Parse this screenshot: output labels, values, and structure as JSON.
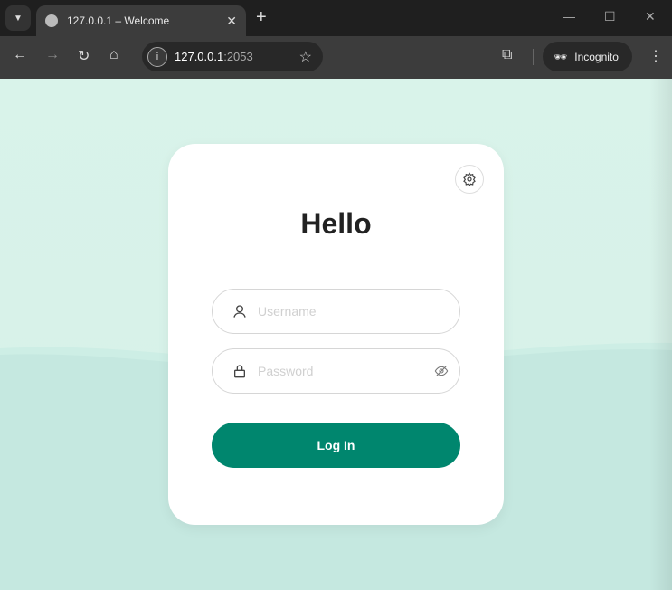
{
  "browser": {
    "tab_title": "127.0.0.1 – Welcome",
    "url_host": "127.0.0.1",
    "url_port": ":2053",
    "incognito_label": "Incognito"
  },
  "login": {
    "title": "Hello",
    "username_placeholder": "Username",
    "password_placeholder": "Password",
    "login_label": "Log In"
  },
  "colors": {
    "accent": "#00866e",
    "background": "#d9f3ea"
  }
}
